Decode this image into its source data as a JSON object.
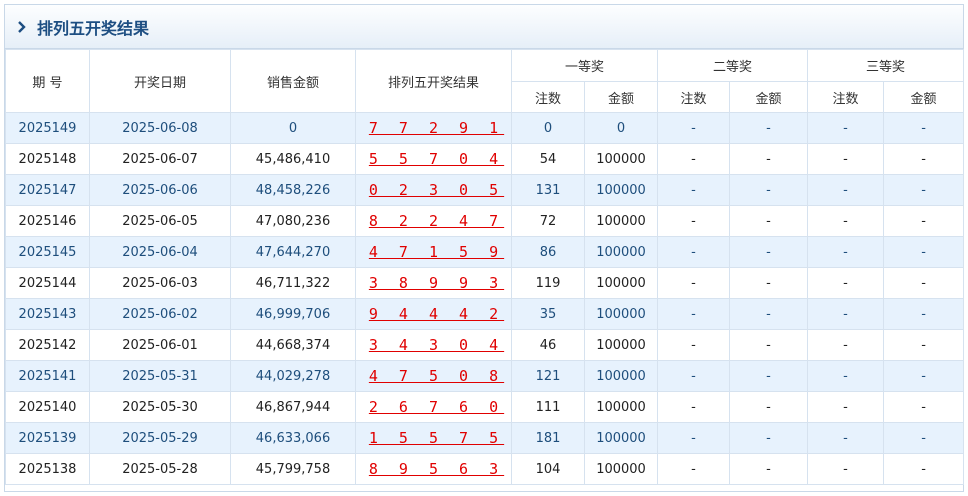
{
  "title": "排列五开奖结果",
  "headers": {
    "issue": "期 号",
    "date": "开奖日期",
    "sales": "销售金额",
    "result": "排列五开奖结果",
    "first_prize": "一等奖",
    "second_prize": "二等奖",
    "third_prize": "三等奖",
    "count": "注数",
    "amount": "金额"
  },
  "rows": [
    {
      "issue": "2025149",
      "date": "2025-06-08",
      "sales": "0",
      "numbers": "7 7 2 9 1",
      "p1_count": "0",
      "p1_amount": "0",
      "p2_count": "-",
      "p2_amount": "-",
      "p3_count": "-",
      "p3_amount": "-"
    },
    {
      "issue": "2025148",
      "date": "2025-06-07",
      "sales": "45,486,410",
      "numbers": "5 5 7 0 4",
      "p1_count": "54",
      "p1_amount": "100000",
      "p2_count": "-",
      "p2_amount": "-",
      "p3_count": "-",
      "p3_amount": "-"
    },
    {
      "issue": "2025147",
      "date": "2025-06-06",
      "sales": "48,458,226",
      "numbers": "0 2 3 0 5",
      "p1_count": "131",
      "p1_amount": "100000",
      "p2_count": "-",
      "p2_amount": "-",
      "p3_count": "-",
      "p3_amount": "-"
    },
    {
      "issue": "2025146",
      "date": "2025-06-05",
      "sales": "47,080,236",
      "numbers": "8 2 2 4 7",
      "p1_count": "72",
      "p1_amount": "100000",
      "p2_count": "-",
      "p2_amount": "-",
      "p3_count": "-",
      "p3_amount": "-"
    },
    {
      "issue": "2025145",
      "date": "2025-06-04",
      "sales": "47,644,270",
      "numbers": "4 7 1 5 9",
      "p1_count": "86",
      "p1_amount": "100000",
      "p2_count": "-",
      "p2_amount": "-",
      "p3_count": "-",
      "p3_amount": "-"
    },
    {
      "issue": "2025144",
      "date": "2025-06-03",
      "sales": "46,711,322",
      "numbers": "3 8 9 9 3",
      "p1_count": "119",
      "p1_amount": "100000",
      "p2_count": "-",
      "p2_amount": "-",
      "p3_count": "-",
      "p3_amount": "-"
    },
    {
      "issue": "2025143",
      "date": "2025-06-02",
      "sales": "46,999,706",
      "numbers": "9 4 4 4 2",
      "p1_count": "35",
      "p1_amount": "100000",
      "p2_count": "-",
      "p2_amount": "-",
      "p3_count": "-",
      "p3_amount": "-"
    },
    {
      "issue": "2025142",
      "date": "2025-06-01",
      "sales": "44,668,374",
      "numbers": "3 4 3 0 4",
      "p1_count": "46",
      "p1_amount": "100000",
      "p2_count": "-",
      "p2_amount": "-",
      "p3_count": "-",
      "p3_amount": "-"
    },
    {
      "issue": "2025141",
      "date": "2025-05-31",
      "sales": "44,029,278",
      "numbers": "4 7 5 0 8",
      "p1_count": "121",
      "p1_amount": "100000",
      "p2_count": "-",
      "p2_amount": "-",
      "p3_count": "-",
      "p3_amount": "-"
    },
    {
      "issue": "2025140",
      "date": "2025-05-30",
      "sales": "46,867,944",
      "numbers": "2 6 7 6 0",
      "p1_count": "111",
      "p1_amount": "100000",
      "p2_count": "-",
      "p2_amount": "-",
      "p3_count": "-",
      "p3_amount": "-"
    },
    {
      "issue": "2025139",
      "date": "2025-05-29",
      "sales": "46,633,066",
      "numbers": "1 5 5 7 5",
      "p1_count": "181",
      "p1_amount": "100000",
      "p2_count": "-",
      "p2_amount": "-",
      "p3_count": "-",
      "p3_amount": "-"
    },
    {
      "issue": "2025138",
      "date": "2025-05-28",
      "sales": "45,799,758",
      "numbers": "8 9 5 6 3",
      "p1_count": "104",
      "p1_amount": "100000",
      "p2_count": "-",
      "p2_amount": "-",
      "p3_count": "-",
      "p3_amount": "-"
    }
  ],
  "colors": {
    "title": "#1d4e82",
    "ball_link": "#e00000",
    "alt_row": "#e7f2fd",
    "border": "#d6e2ef"
  },
  "icons": {
    "title_marker": "chevron-right-icon"
  }
}
